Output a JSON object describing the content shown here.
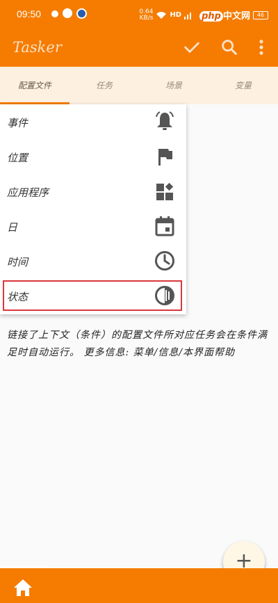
{
  "status_bar": {
    "time": "09:50",
    "network_speed": "0.64",
    "network_unit": "KB/s",
    "network_type": "HD",
    "battery": "46",
    "watermark_php": "php",
    "watermark_text": "中文网"
  },
  "app_bar": {
    "title": "Tasker",
    "check_icon": "check-icon",
    "search_icon": "search-icon",
    "more_icon": "more-vert-icon"
  },
  "tabs": [
    {
      "label": "配置文件",
      "selected": true
    },
    {
      "label": "任务",
      "selected": false
    },
    {
      "label": "场景",
      "selected": false
    },
    {
      "label": "变量",
      "selected": false
    }
  ],
  "menu": {
    "items": [
      {
        "label": "事件",
        "icon": "bell-icon"
      },
      {
        "label": "位置",
        "icon": "flag-icon"
      },
      {
        "label": "应用程序",
        "icon": "apps-icon"
      },
      {
        "label": "日",
        "icon": "calendar-icon"
      },
      {
        "label": "时间",
        "icon": "clock-icon"
      },
      {
        "label": "状态",
        "icon": "contrast-icon",
        "highlighted": true
      }
    ]
  },
  "explanation": "链接了上下文（条件）的配置文件所对应任务会在条件满足时自动运行。 更多信息: 菜单/信息/本界面帮助",
  "fab": {
    "label": "+",
    "icon": "add-icon"
  },
  "bottom_bar": {
    "icon": "home-icon"
  },
  "colors": {
    "primary": "#f57c00",
    "tab_bg": "#fdf0e0",
    "highlight": "#d9373a",
    "icon": "#555555"
  }
}
